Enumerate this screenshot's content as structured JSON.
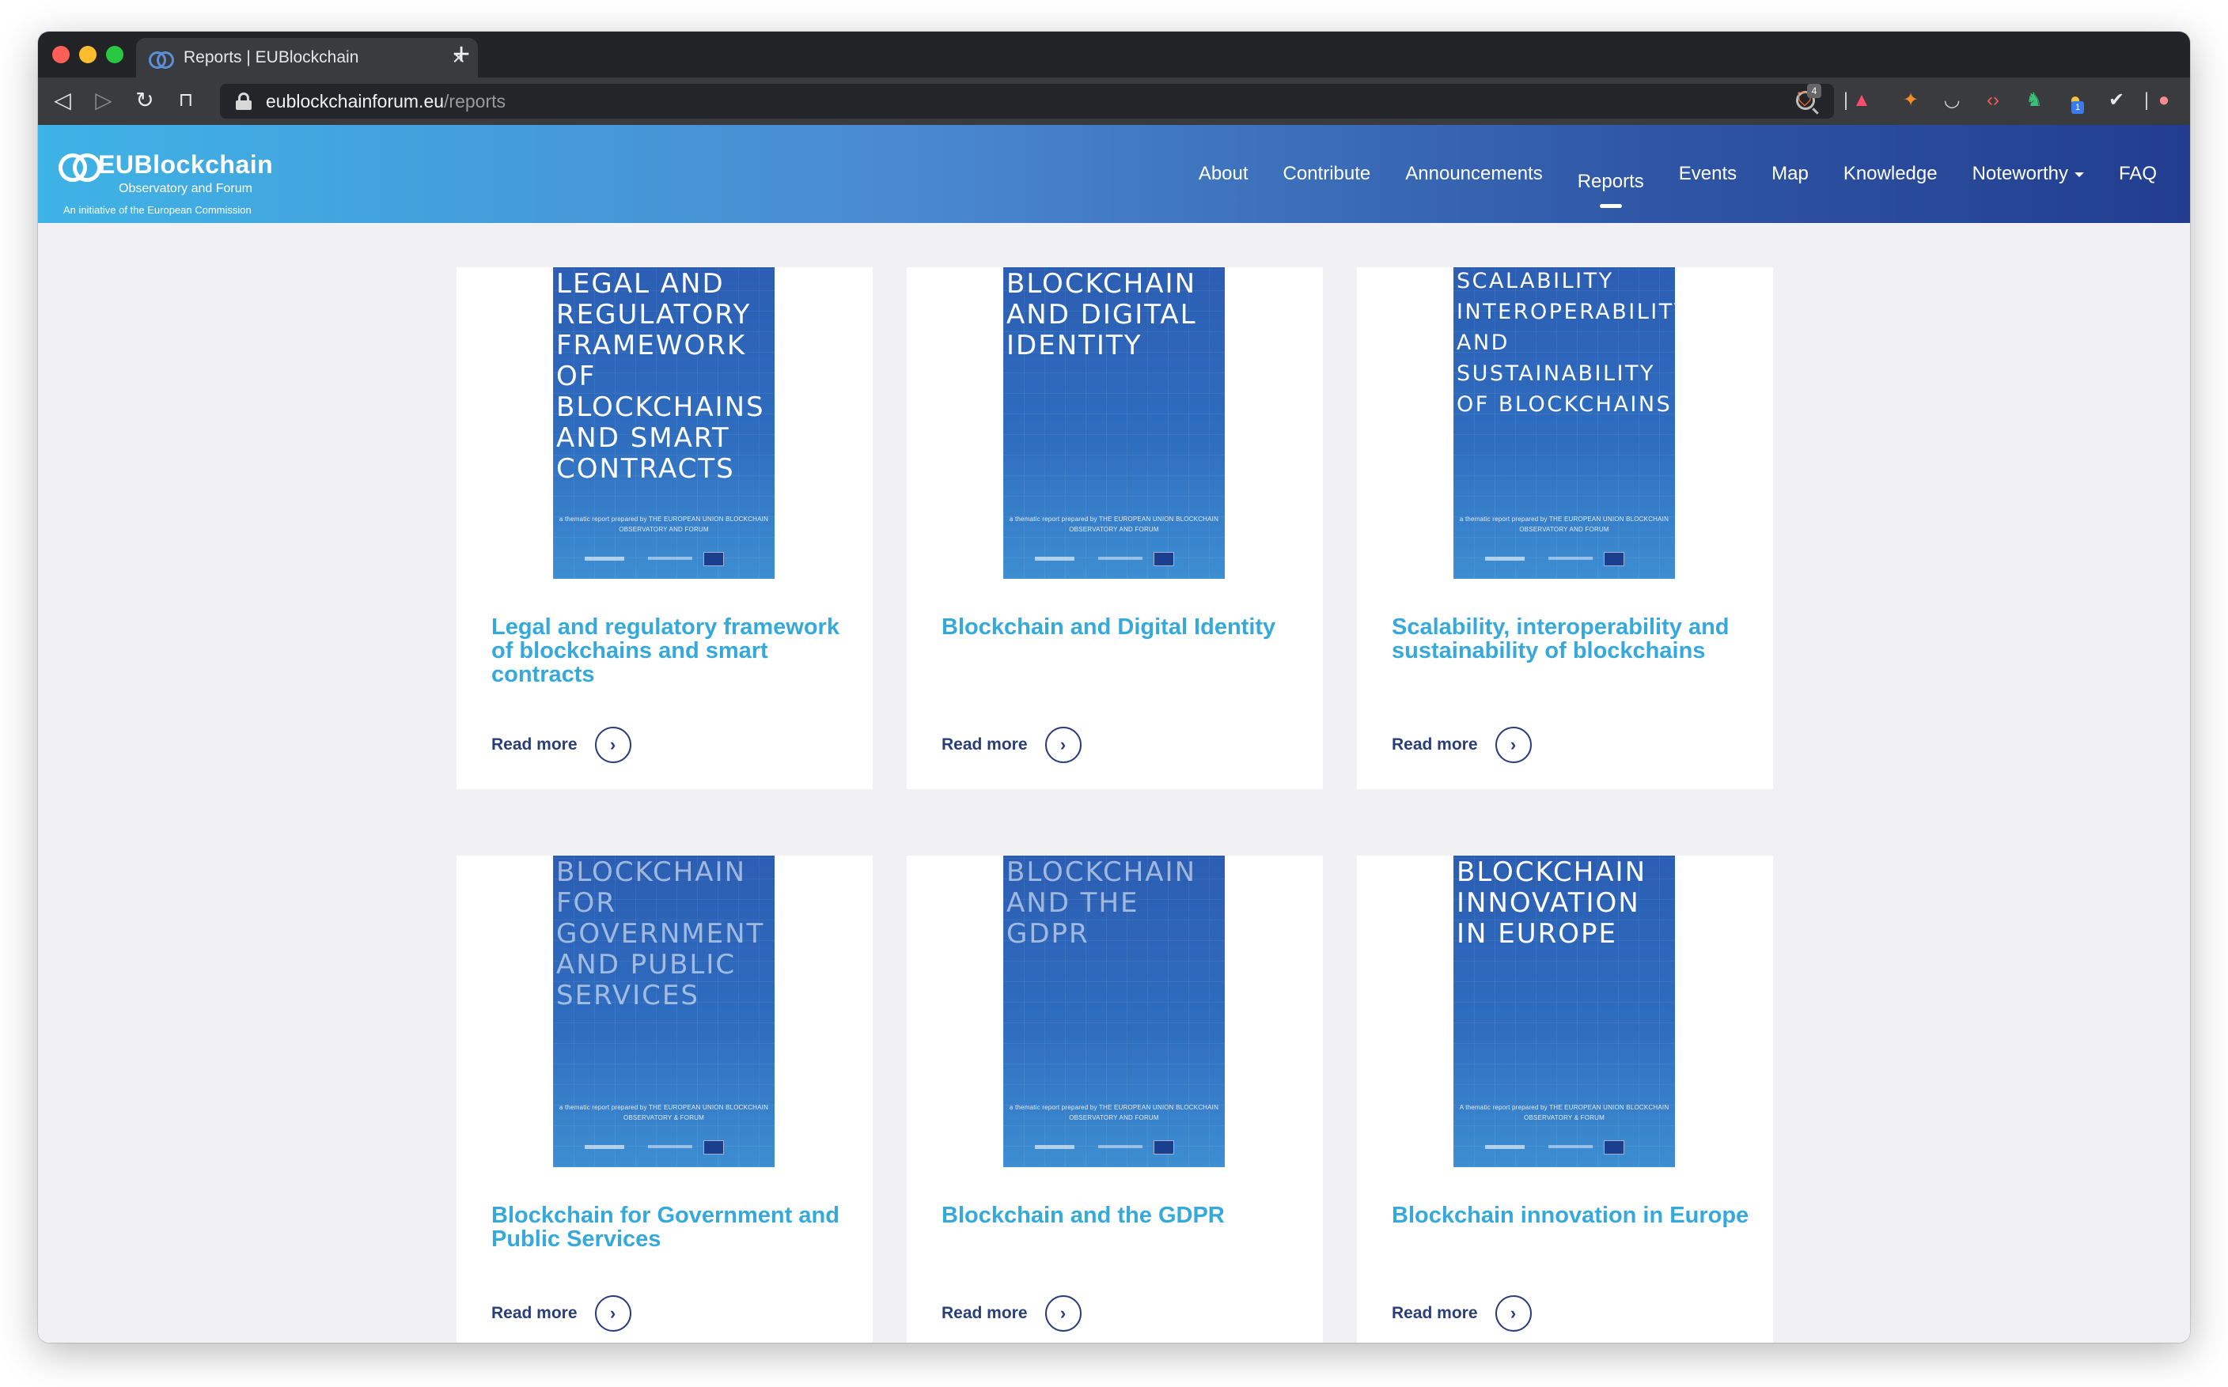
{
  "browser": {
    "tab_title": "Reports | EUBlockchain",
    "tab_close": "×",
    "new_tab": "+",
    "url_host": "eublockchainforum.eu",
    "url_path": "/reports",
    "extension_badge": "4",
    "extension_badge_2": "1"
  },
  "site": {
    "logo_name": "EUBlockchain",
    "logo_sub": "Observatory and Forum",
    "logo_initiative": "An initiative of the European Commission",
    "nav": [
      "About",
      "Contribute",
      "Announcements",
      "Reports",
      "Events",
      "Map",
      "Knowledge",
      "Noteworthy",
      "FAQ"
    ],
    "active_nav": "Reports"
  },
  "reports": [
    {
      "cover_lines": "LEGAL AND REGULATORY FRAMEWORK OF BLOCKCHAINS AND SMART CONTRACTS",
      "cover_foot": "a thematic report prepared by THE EUROPEAN UNION BLOCKCHAIN OBSERVATORY AND FORUM",
      "title": "Legal and regulatory framework of blockchains and smart contracts",
      "link": "Read more"
    },
    {
      "cover_lines": "BLOCKCHAIN AND DIGITAL IDENTITY",
      "cover_foot": "a thematic report prepared by THE EUROPEAN UNION BLOCKCHAIN OBSERVATORY AND FORUM",
      "title": "Blockchain and Digital Identity",
      "link": "Read more"
    },
    {
      "cover_lines": "SCALABILITY INTEROPERABILITY AND SUSTAINABILITY OF BLOCKCHAINS",
      "cover_foot": "a thematic report prepared by THE EUROPEAN UNION BLOCKCHAIN OBSERVATORY AND FORUM",
      "title": "Scalability, interoperability and sustainability of blockchains",
      "link": "Read more"
    },
    {
      "cover_lines": "BLOCKCHAIN FOR GOVERNMENT AND PUBLIC SERVICES",
      "cover_foot": "a thematic report prepared by THE EUROPEAN UNION BLOCKCHAIN OBSERVATORY & FORUM",
      "title": "Blockchain for Government and Public Services",
      "link": "Read more"
    },
    {
      "cover_lines": "BLOCKCHAIN AND THE GDPR",
      "cover_foot": "a thematic report prepared by THE EUROPEAN UNION BLOCKCHAIN OBSERVATORY AND FORUM",
      "title": "Blockchain and the GDPR",
      "link": "Read more"
    },
    {
      "cover_lines": "BLOCKCHAIN INNOVATION IN EUROPE",
      "cover_foot": "A thematic report prepared by THE EUROPEAN UNION BLOCKCHAIN OBSERVATORY & FORUM",
      "title": "Blockchain innovation in Europe",
      "link": "Read more"
    }
  ],
  "colors": {
    "title_accent": "#36a9dc",
    "link": "#2a3e7a",
    "header_start": "#3eb3e6",
    "header_end": "#223d8f"
  }
}
